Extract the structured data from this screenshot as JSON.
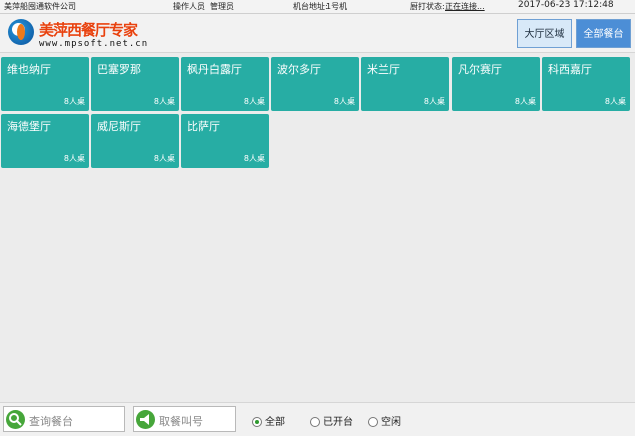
{
  "statusbar": {
    "company": "美萍船囤通软件公司",
    "operator_label": "操作人员",
    "operator_value": "管理员",
    "machine_label": "机台地址:",
    "machine_value": "1号机",
    "print_label": "厨打状态:",
    "print_value": "正在连接...",
    "datetime": "2017-06-23 17:12:48"
  },
  "header": {
    "logo_title": "美萍西餐厅专家",
    "logo_url": "www.mpsoft.net.cn",
    "tabs": [
      {
        "label": "大厅区域",
        "active": true
      },
      {
        "label": "全部餐台",
        "active": false
      }
    ]
  },
  "tables": [
    {
      "name": "维也纳厅",
      "capacity": "8人桌"
    },
    {
      "name": "巴塞罗那",
      "capacity": "8人桌"
    },
    {
      "name": "枫丹白露厅",
      "capacity": "8人桌"
    },
    {
      "name": "波尔多厅",
      "capacity": "8人桌"
    },
    {
      "name": "米兰厅",
      "capacity": "8人桌"
    },
    {
      "name": "凡尔赛厅",
      "capacity": "8人桌"
    },
    {
      "name": "科西嘉厅",
      "capacity": "8人桌"
    },
    {
      "name": "海德堡厅",
      "capacity": "8人桌"
    },
    {
      "name": "威尼斯厅",
      "capacity": "8人桌"
    },
    {
      "name": "比萨厅",
      "capacity": "8人桌"
    }
  ],
  "bottombar": {
    "search_placeholder": "查询餐台",
    "call_placeholder": "取餐叫号",
    "filters": [
      {
        "label": "全部",
        "checked": true
      },
      {
        "label": "已开台",
        "checked": false
      },
      {
        "label": "空闲",
        "checked": false
      }
    ]
  },
  "colors": {
    "tile": "#27ada4",
    "tab_active": "#d8e9f8",
    "tab_other": "#4c8ed6",
    "icon_green": "#46a63a"
  }
}
